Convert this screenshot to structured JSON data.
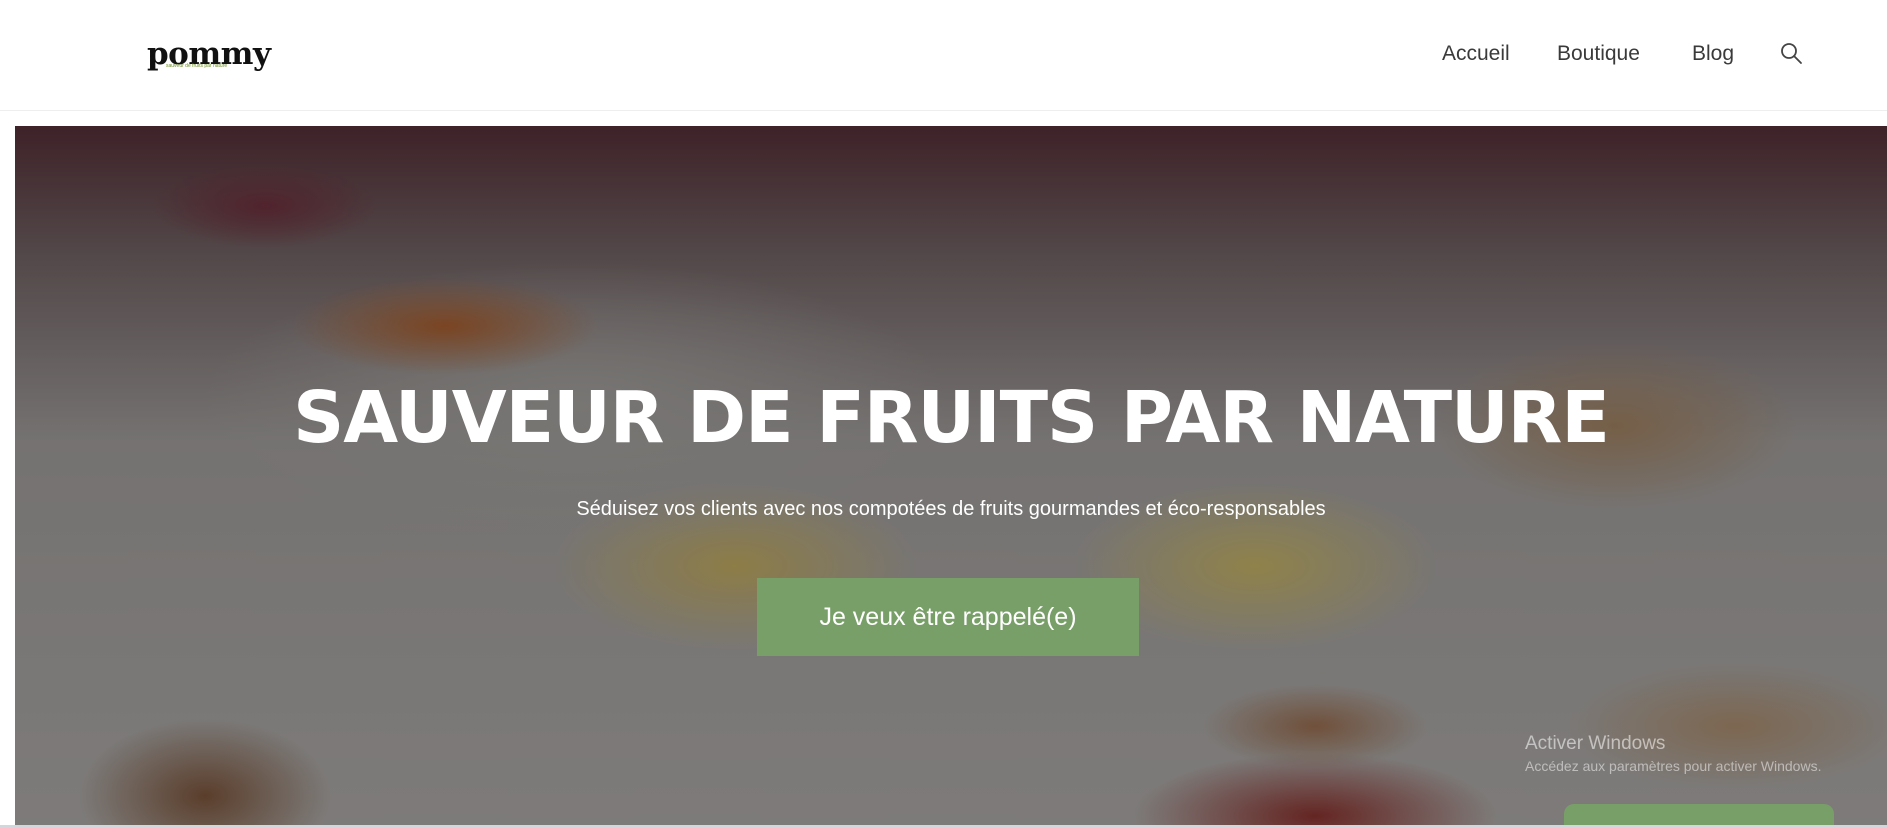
{
  "brand": {
    "name": "pommy",
    "tagline": "sauveur de fruits par nature"
  },
  "nav": {
    "items": [
      {
        "label": "Accueil"
      },
      {
        "label": "Boutique"
      },
      {
        "label": "Blog"
      }
    ],
    "search_icon": "search-icon"
  },
  "hero": {
    "title": "SAUVEUR DE FRUITS PAR NATURE",
    "subtitle": "Séduisez vos clients avec nos compotées de fruits gourmandes et éco-responsables",
    "cta_label": "Je veux être rappelé(e)"
  },
  "windows_notice": {
    "title": "Activer Windows",
    "subtitle": "Accédez aux paramètres pour activer Windows."
  },
  "colors": {
    "accent": "#799f69",
    "nav_text": "#3a3a3a",
    "header_bg": "#ffffff"
  }
}
